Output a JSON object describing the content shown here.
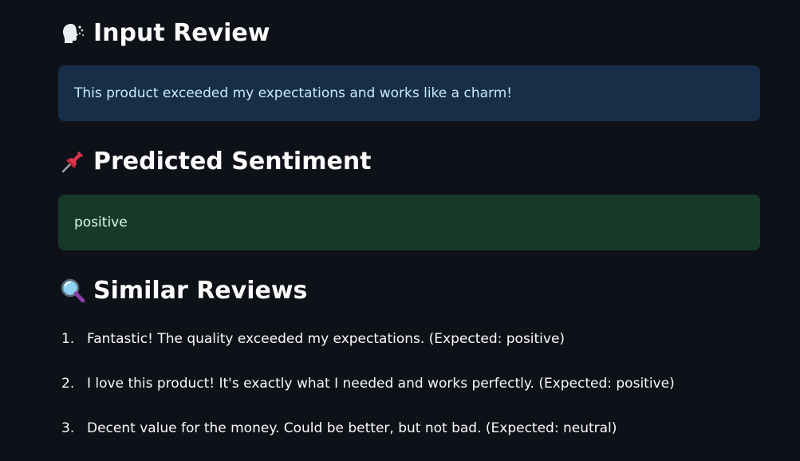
{
  "input_review": {
    "heading": "Input Review",
    "icon": "speaking-head-icon",
    "text": "This product exceeded my expectations and works like a charm!"
  },
  "prediction": {
    "heading": "Predicted Sentiment",
    "icon": "pushpin-icon",
    "value": "positive"
  },
  "similar": {
    "heading": "Similar Reviews",
    "icon": "magnifier-icon",
    "items": [
      {
        "num": "1.",
        "text": "Fantastic! The quality exceeded my expectations. (Expected: positive)"
      },
      {
        "num": "2.",
        "text": "I love this product! It's exactly what I needed and works perfectly. (Expected: positive)"
      },
      {
        "num": "3.",
        "text": "Decent value for the money. Could be better, but not bad. (Expected: neutral)"
      }
    ]
  },
  "colors": {
    "background": "#0e1117",
    "info_bg": "#172d48",
    "info_text": "#c7ebff",
    "success_bg": "#173928",
    "success_text": "#dffde9"
  }
}
